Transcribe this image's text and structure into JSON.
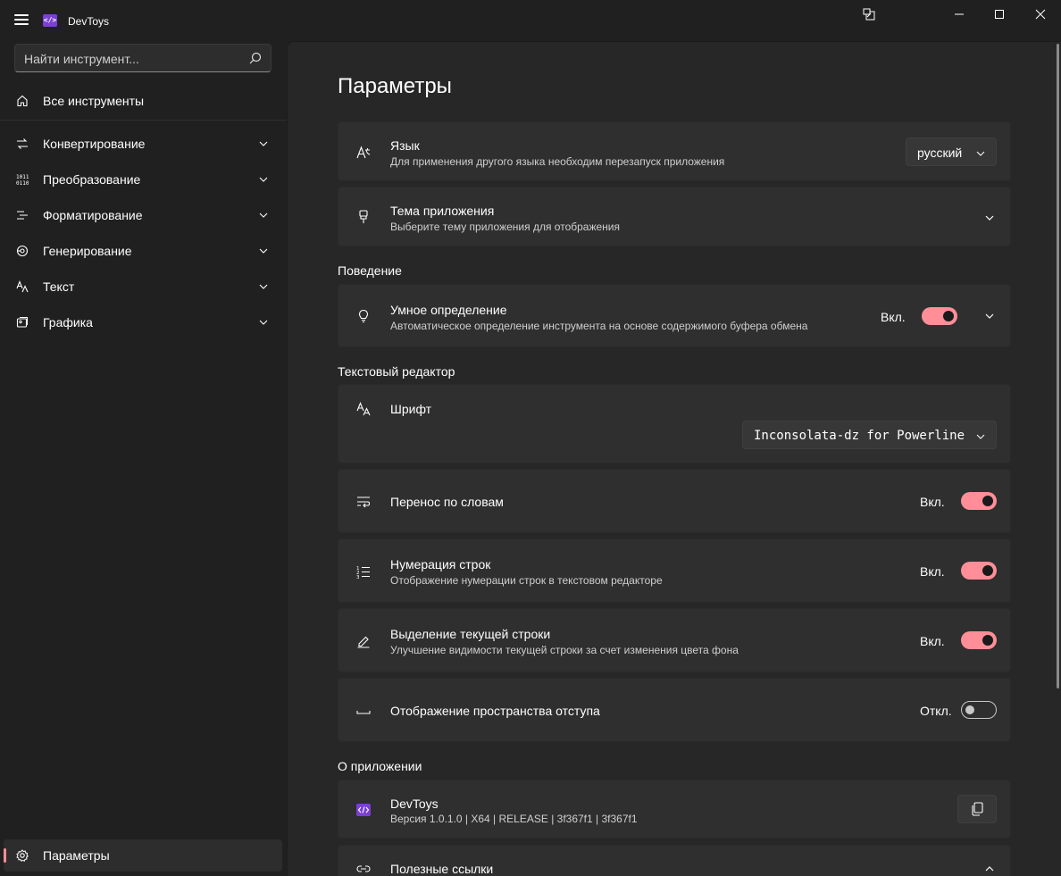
{
  "app": {
    "title": "DevToys",
    "logo_text": "</>"
  },
  "search": {
    "placeholder": "Найти инструмент..."
  },
  "sidebar": {
    "all_tools": "Все инструменты",
    "items": [
      {
        "label": "Конвертирование",
        "icon": "convert-icon"
      },
      {
        "label": "Преобразование",
        "icon": "binary-icon"
      },
      {
        "label": "Форматирование",
        "icon": "format-icon"
      },
      {
        "label": "Генерирование",
        "icon": "generate-icon"
      },
      {
        "label": "Текст",
        "icon": "text-icon"
      },
      {
        "label": "Графика",
        "icon": "graphics-icon"
      }
    ],
    "settings": "Параметры"
  },
  "page": {
    "title": "Параметры"
  },
  "settings": {
    "language": {
      "title": "Язык",
      "subtitle": "Для применения другого языка необходим перезапуск приложения",
      "value": "русский"
    },
    "theme": {
      "title": "Тема приложения",
      "subtitle": "Выберите тему приложения для отображения"
    },
    "behavior_label": "Поведение",
    "smart": {
      "title": "Умное определение",
      "subtitle": "Автоматическое определение инструмента на основе содержимого буфера обмена",
      "state": "Вкл."
    },
    "editor_label": "Текстовый редактор",
    "font": {
      "title": "Шрифт",
      "value": "Inconsolata-dz for Powerline"
    },
    "wrap": {
      "title": "Перенос по словам",
      "state": "Вкл."
    },
    "line_numbers": {
      "title": "Нумерация строк",
      "subtitle": "Отображение нумерации строк в текстовом редакторе",
      "state": "Вкл."
    },
    "highlight": {
      "title": "Выделение текущей строки",
      "subtitle": "Улучшение видимости текущей строки за счет изменения цвета фона",
      "state": "Вкл."
    },
    "whitespace": {
      "title": "Отображение пространства отступа",
      "state": "Откл."
    },
    "about_label": "О приложении",
    "about": {
      "title": "DevToys",
      "subtitle": "Версия 1.0.1.0 | X64 | RELEASE | 3f367f1 | 3f367f1"
    },
    "links": {
      "title": "Полезные ссылки"
    }
  },
  "colors": {
    "accent": "#ff8e98",
    "background": "#202020",
    "card": "#2f2f2f",
    "logo": "#7b3fd6"
  }
}
